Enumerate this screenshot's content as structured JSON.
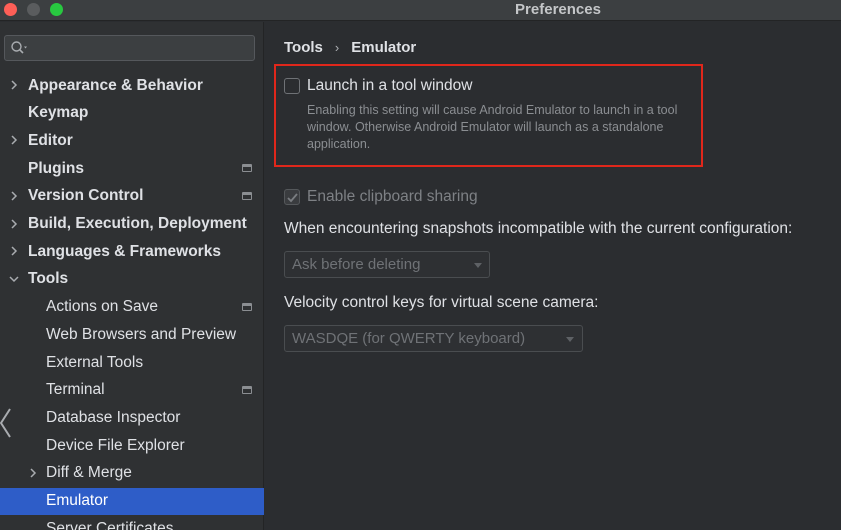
{
  "window": {
    "title": "Preferences"
  },
  "search": {
    "placeholder": ""
  },
  "sidebar": {
    "items": [
      {
        "label": "Appearance & Behavior",
        "expandable": true,
        "expanded": false,
        "level": 0,
        "bold": true,
        "project_icon": false
      },
      {
        "label": "Keymap",
        "expandable": false,
        "level": 0,
        "bold": true,
        "project_icon": false
      },
      {
        "label": "Editor",
        "expandable": true,
        "expanded": false,
        "level": 0,
        "bold": true,
        "project_icon": false
      },
      {
        "label": "Plugins",
        "expandable": false,
        "level": 0,
        "bold": true,
        "project_icon": true
      },
      {
        "label": "Version Control",
        "expandable": true,
        "expanded": false,
        "level": 0,
        "bold": true,
        "project_icon": true
      },
      {
        "label": "Build, Execution, Deployment",
        "expandable": true,
        "expanded": false,
        "level": 0,
        "bold": true,
        "project_icon": false
      },
      {
        "label": "Languages & Frameworks",
        "expandable": true,
        "expanded": false,
        "level": 0,
        "bold": true,
        "project_icon": false
      },
      {
        "label": "Tools",
        "expandable": true,
        "expanded": true,
        "level": 0,
        "bold": true,
        "project_icon": false
      },
      {
        "label": "Actions on Save",
        "expandable": false,
        "level": 1,
        "bold": false,
        "project_icon": true
      },
      {
        "label": "Web Browsers and Preview",
        "expandable": false,
        "level": 1,
        "bold": false,
        "project_icon": false
      },
      {
        "label": "External Tools",
        "expandable": false,
        "level": 1,
        "bold": false,
        "project_icon": false
      },
      {
        "label": "Terminal",
        "expandable": false,
        "level": 1,
        "bold": false,
        "project_icon": true
      },
      {
        "label": "Database Inspector",
        "expandable": false,
        "level": 1,
        "bold": false,
        "project_icon": false
      },
      {
        "label": "Device File Explorer",
        "expandable": false,
        "level": 1,
        "bold": false,
        "project_icon": false
      },
      {
        "label": "Diff & Merge",
        "expandable": true,
        "expanded": false,
        "level": 1,
        "bold": false,
        "project_icon": false
      },
      {
        "label": "Emulator",
        "expandable": false,
        "level": 1,
        "bold": false,
        "project_icon": false,
        "selected": true
      },
      {
        "label": "Server Certificates",
        "expandable": false,
        "level": 1,
        "bold": false,
        "project_icon": false
      }
    ]
  },
  "breadcrumb": {
    "parent": "Tools",
    "separator": "›",
    "current": "Emulator"
  },
  "settings": {
    "launch_in_tool_window": {
      "label": "Launch in a tool window",
      "checked": false,
      "description": "Enabling this setting will cause Android Emulator to launch in a tool window. Otherwise Android Emulator will launch as a standalone application."
    },
    "clipboard_sharing": {
      "label": "Enable clipboard sharing",
      "checked": true,
      "disabled": true
    },
    "snapshots_prompt": "When encountering snapshots incompatible with the current configuration:",
    "snapshots_combo": {
      "value": "Ask before deleting"
    },
    "velocity_prompt": "Velocity control keys for virtual scene camera:",
    "velocity_combo": {
      "value": "WASDQE (for QWERTY keyboard)"
    }
  },
  "colors": {
    "selection": "#2e5dc8",
    "highlight_border": "#e0271b",
    "sidebar_bg": "#2f3133",
    "main_bg": "#2b2d30"
  }
}
